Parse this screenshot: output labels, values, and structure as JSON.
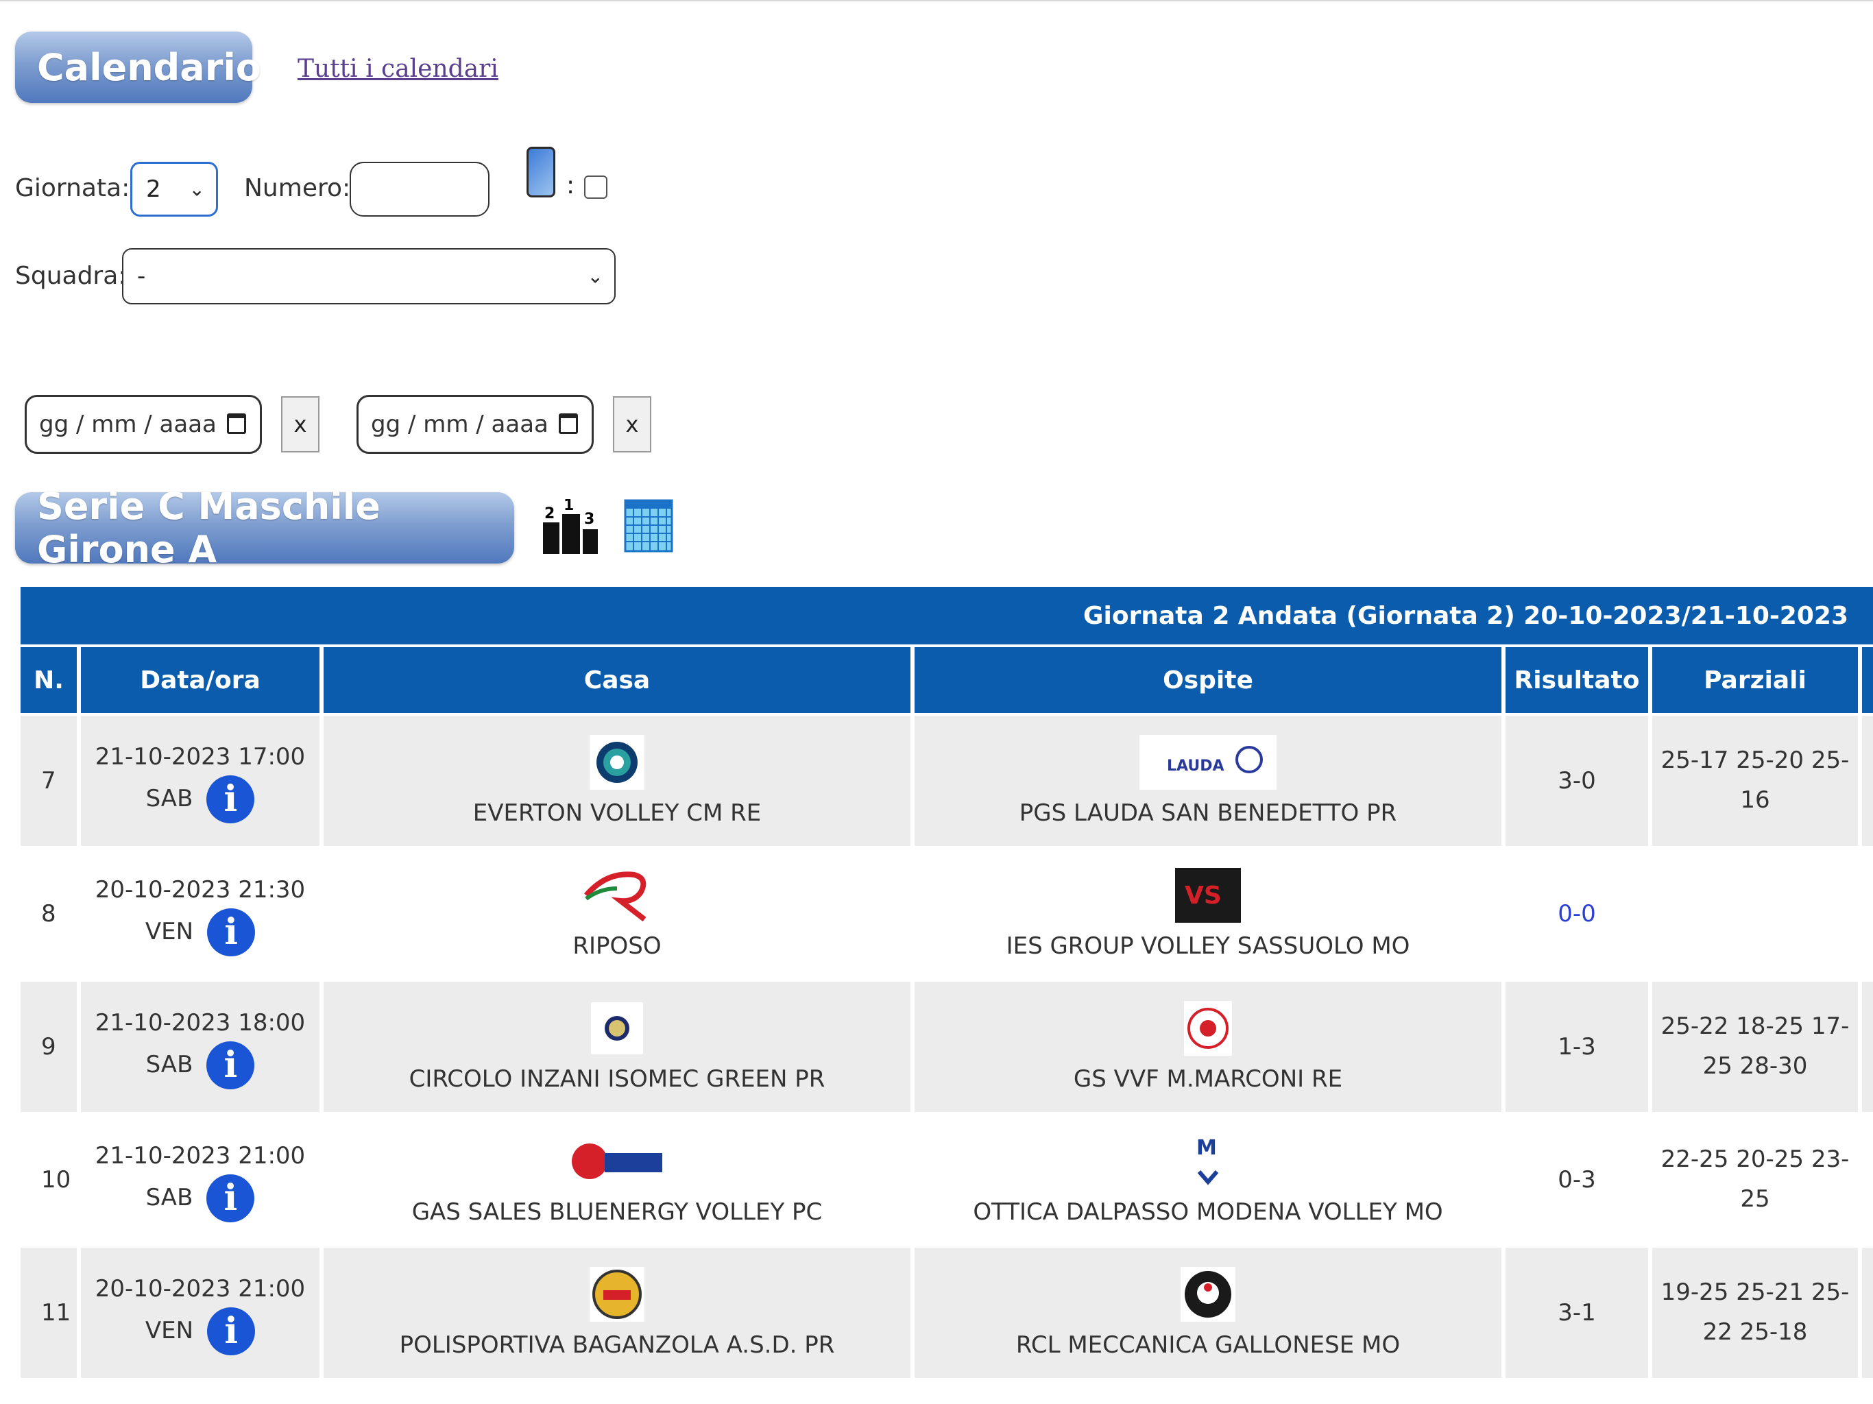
{
  "header": {
    "title": "Calendario",
    "link": "Tutti i calendari"
  },
  "filters": {
    "giornata_label": "Giornata:",
    "giornata_value": "2",
    "numero_label": "Numero:",
    "numero_value": "",
    "colon": ":",
    "squadra_label": "Squadra:",
    "squadra_value": "-",
    "date_from_placeholder": "gg / mm / aaaa",
    "date_to_placeholder": "gg / mm / aaaa",
    "clear_label": "x"
  },
  "section": {
    "title": "Serie C Maschile Girone A"
  },
  "table": {
    "banner": "Giornata 2 Andata (Giornata 2) 20-10-2023/21-10-2023",
    "columns": [
      "N.",
      "Data/ora",
      "Casa",
      "Ospite",
      "Risultato",
      "Parziali"
    ],
    "rows": [
      {
        "n": "7",
        "datetime": "21-10-2023 17:00",
        "day": "SAB",
        "home": "EVERTON VOLLEY CM RE",
        "away": "PGS LAUDA SAN BENEDETTO PR",
        "result": "3-0",
        "sets": [
          "25-17 25-20 25-",
          "16"
        ]
      },
      {
        "n": "8",
        "datetime": "20-10-2023 21:30",
        "day": "VEN",
        "home": "RIPOSO",
        "away": "IES GROUP VOLLEY SASSUOLO MO",
        "result": "0-0",
        "sets": [
          "",
          ""
        ]
      },
      {
        "n": "9",
        "datetime": "21-10-2023 18:00",
        "day": "SAB",
        "home": "CIRCOLO INZANI ISOMEC GREEN PR",
        "away": "GS VVF M.MARCONI RE",
        "result": "1-3",
        "sets": [
          "25-22 18-25 17-",
          "25 28-30"
        ]
      },
      {
        "n": "10",
        "datetime": "21-10-2023 21:00",
        "day": "SAB",
        "home": "GAS SALES BLUENERGY VOLLEY PC",
        "away": "OTTICA DALPASSO MODENA VOLLEY MO",
        "result": "0-3",
        "sets": [
          "22-25 20-25 23-",
          "25"
        ]
      },
      {
        "n": "11",
        "datetime": "20-10-2023 21:00",
        "day": "VEN",
        "home": "POLISPORTIVA BAGANZOLA A.S.D. PR",
        "away": "RCL MECCANICA GALLONESE MO",
        "result": "3-1",
        "sets": [
          "19-25 25-21 25-",
          "22 25-18"
        ]
      }
    ]
  },
  "colors": {
    "header_blue": "#0b5cad",
    "info_blue": "#1a55d6",
    "link_purple": "#5a3f8f"
  },
  "icons": [
    "phone-icon",
    "podium-icon",
    "calendar-grid-icon",
    "info-icon",
    "calendar-icon"
  ]
}
